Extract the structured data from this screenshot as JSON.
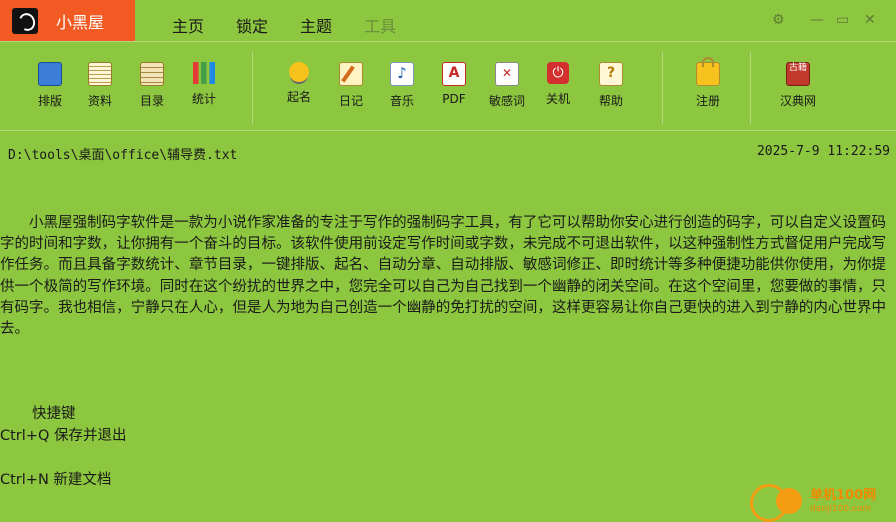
{
  "app": {
    "title": "小黑屋"
  },
  "menu": [
    {
      "label": "主页",
      "enabled": true
    },
    {
      "label": "锁定",
      "enabled": true
    },
    {
      "label": "主题",
      "enabled": true
    },
    {
      "label": "工具",
      "enabled": false
    }
  ],
  "window_controls": {
    "settings": "⚙",
    "minimize": "—",
    "maximize": "▭",
    "close": "✕"
  },
  "toolbar": {
    "groups": [
      [
        {
          "label": "排版",
          "icon": "layout-icon"
        },
        {
          "label": "资料",
          "icon": "material-icon"
        },
        {
          "label": "目录",
          "icon": "catalog-icon"
        },
        {
          "label": "统计",
          "icon": "stats-icon"
        }
      ],
      [
        {
          "label": "起名",
          "icon": "lightbulb-icon"
        },
        {
          "label": "日记",
          "icon": "diary-icon"
        },
        {
          "label": "音乐",
          "icon": "music-icon",
          "glyph": "♪"
        },
        {
          "label": "PDF",
          "icon": "pdf-icon",
          "glyph": "A"
        },
        {
          "label": "敏感词",
          "icon": "sensitive-word-icon",
          "glyph": "✕"
        },
        {
          "label": "关机",
          "icon": "power-icon",
          "glyph": "⏻"
        },
        {
          "label": "帮助",
          "icon": "help-icon",
          "glyph": "?"
        }
      ],
      [
        {
          "label": "注册",
          "icon": "lock-icon"
        }
      ],
      [
        {
          "label": "汉典网",
          "icon": "handian-icon",
          "glyph": "古籍"
        }
      ]
    ]
  },
  "status": {
    "file_path": "D:\\tools\\桌面\\office\\辅导费.txt",
    "datetime": "2025-7-9 11:22:59"
  },
  "editor": {
    "paragraph": "小黑屋强制码字软件是一款为小说作家准备的专注于写作的强制码字工具，有了它可以帮助你安心进行创造的码字，可以自定义设置码字的时间和字数，让你拥有一个奋斗的目标。该软件使用前设定写作时间或字数，未完成不可退出软件，以这种强制性方式督促用户完成写作任务。而且具备字数统计、章节目录，一键排版、起名、自动分章、自动排版、敏感词修正、即时统计等多种便捷功能供你使用，为你提供一个极简的写作环境。同时在这个纷扰的世界之中，您完全可以自己为自己找到一个幽静的闭关空间。在这个空间里，您要做的事情，只有码字。我也相信，宁静只在人心，但是人为地为自己创造一个幽静的免打扰的空间，这样更容易让你自己更快的进入到宁静的内心世界中去。",
    "shortcuts_header": "快捷键",
    "shortcut_save_exit": "Ctrl+Q 保存并退出",
    "shortcut_new_doc": "Ctrl+N 新建文档"
  },
  "watermark": {
    "text": "单机100网",
    "sub": "danji100.com"
  },
  "colors": {
    "background": "#8dc63f",
    "brand": "#f15a22",
    "accent": "#f39c12"
  }
}
